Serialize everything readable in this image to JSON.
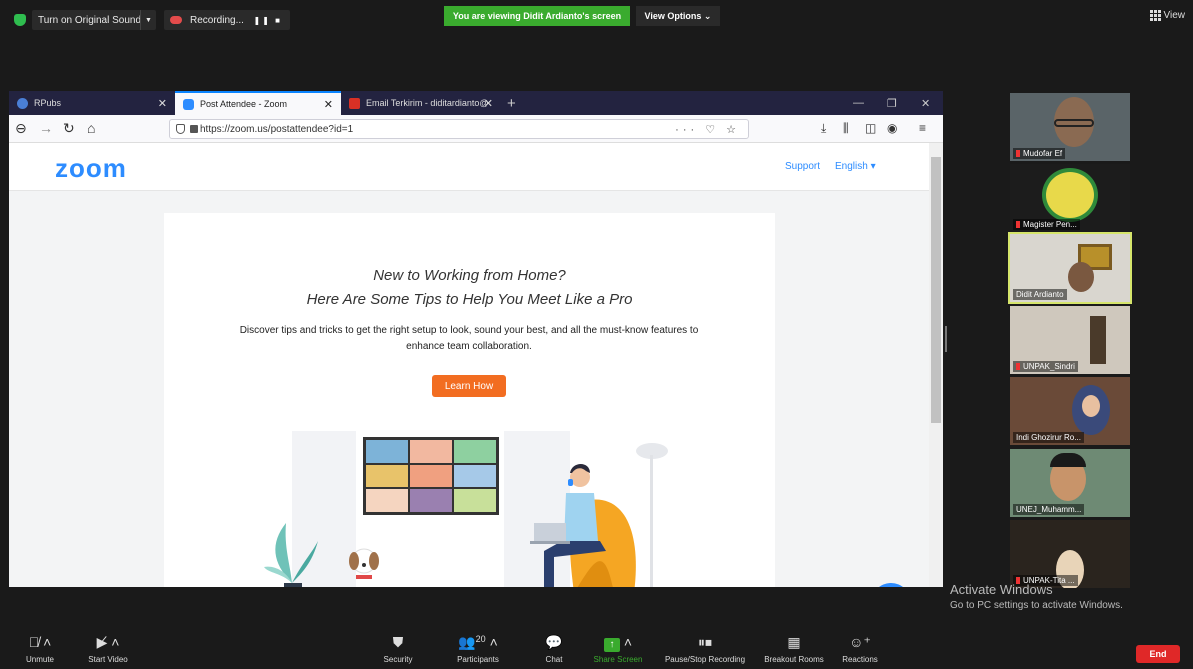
{
  "topbar": {
    "original_sound": "Turn on Original Sound",
    "recording": "Recording...",
    "viewing_banner": "You are viewing Didit Ardianto's screen",
    "view_options": "View Options",
    "view_button": "View"
  },
  "browser": {
    "tabs": [
      {
        "title": "RPubs"
      },
      {
        "title": "Post Attendee - Zoom"
      },
      {
        "title": "Email Terkirim - diditardianto@"
      }
    ],
    "new_tab": "+",
    "url": "https://zoom.us/postattendee?id=1"
  },
  "zoom_page": {
    "logo": "zoom",
    "support": "Support",
    "language": "English",
    "headline_1": "New to Working from Home?",
    "headline_2": "Here Are Some Tips to Help You Meet Like a Pro",
    "description": "Discover tips and tricks to get the right setup to look, sound your best, and all the must-know features to enhance team collaboration.",
    "cta": "Learn How"
  },
  "participants": [
    {
      "name": "Mudofar Ef"
    },
    {
      "name": "Magister Pen..."
    },
    {
      "name": "Didit Ardianto"
    },
    {
      "name": "UNPAK_Sindri"
    },
    {
      "name": "Indi Ghozirur Ro..."
    },
    {
      "name": "UNEJ_Muhamm..."
    },
    {
      "name": "UNPAK-Tita ..."
    }
  ],
  "watermark": {
    "line1": "Activate Windows",
    "line2": "Go to PC settings to activate Windows."
  },
  "toolbar": {
    "unmute": "Unmute",
    "start_video": "Start Video",
    "security": "Security",
    "participants": "Participants",
    "participants_count": "20",
    "chat": "Chat",
    "share_screen": "Share Screen",
    "recording": "Pause/Stop Recording",
    "breakout": "Breakout Rooms",
    "reactions": "Reactions",
    "end": "End"
  },
  "colors": {
    "zoom_blue": "#2d8cff",
    "banner_green": "#3aab2e",
    "cta_orange": "#f26d21",
    "end_red": "#e02828",
    "active_speaker": "#d6e56b"
  }
}
